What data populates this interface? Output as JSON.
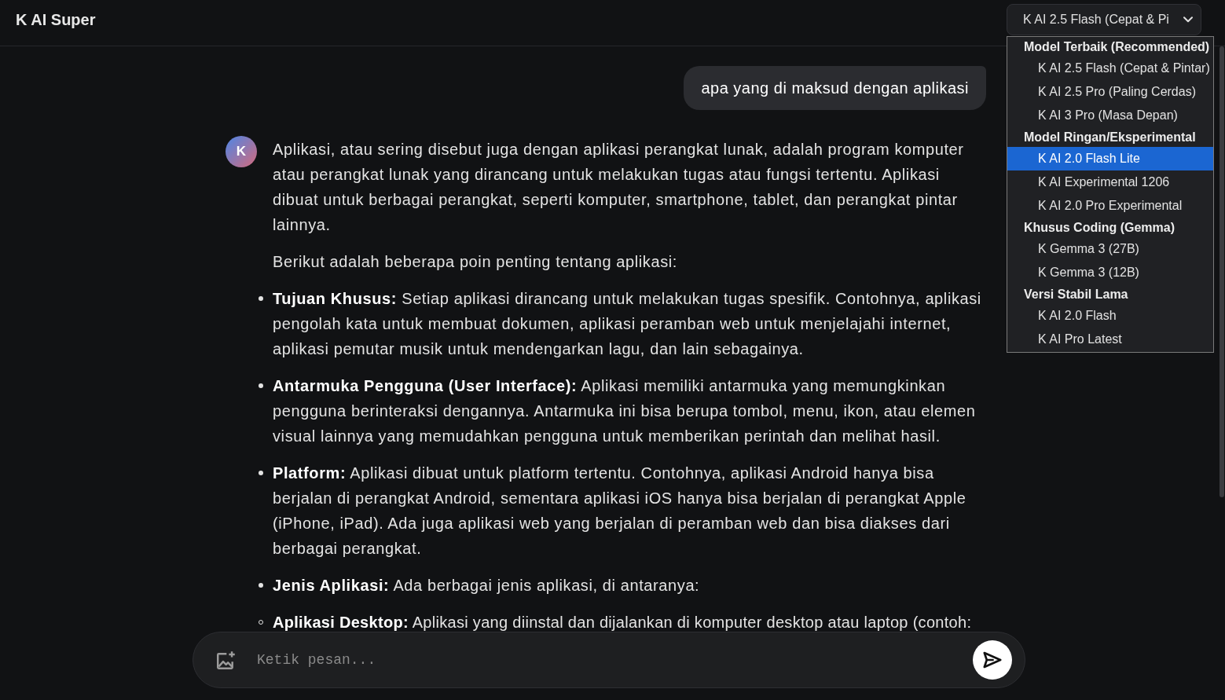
{
  "app": {
    "title": "K AI Super"
  },
  "model_select": {
    "value": "K AI 2.5 Flash (Cepat & Pi",
    "expanded": true,
    "groups": [
      {
        "label": "Model Terbaik (Recommended)",
        "options": [
          {
            "label": "K AI 2.5 Flash (Cepat & Pintar)",
            "selected": false
          },
          {
            "label": "K AI 2.5 Pro (Paling Cerdas)",
            "selected": false
          },
          {
            "label": "K AI 3 Pro (Masa Depan)",
            "selected": false
          }
        ]
      },
      {
        "label": "Model Ringan/Eksperimental",
        "options": [
          {
            "label": "K AI 2.0 Flash Lite",
            "selected": true
          },
          {
            "label": "K AI Experimental 1206",
            "selected": false
          },
          {
            "label": "K AI 2.0 Pro Experimental",
            "selected": false
          }
        ]
      },
      {
        "label": "Khusus Coding (Gemma)",
        "options": [
          {
            "label": "K Gemma 3 (27B)",
            "selected": false
          },
          {
            "label": "K Gemma 3 (12B)",
            "selected": false
          }
        ]
      },
      {
        "label": "Versi Stabil Lama",
        "options": [
          {
            "label": "K AI 2.0 Flash",
            "selected": false
          },
          {
            "label": "K AI Pro Latest",
            "selected": false
          }
        ]
      }
    ]
  },
  "messages": [
    {
      "kind": "user",
      "text": "apa yang di maksud dengan aplikasi"
    },
    {
      "kind": "assistant",
      "avatar": "K",
      "paragraphs": [
        "Aplikasi, atau sering disebut juga dengan aplikasi perangkat lunak, adalah program komputer atau perangkat lunak yang dirancang untuk melakukan tugas atau fungsi tertentu. Aplikasi dibuat untuk berbagai perangkat, seperti komputer, smartphone, tablet, dan perangkat pintar lainnya.",
        "Berikut adalah beberapa poin penting tentang aplikasi:"
      ],
      "bullets": [
        {
          "text": "**Tujuan Khusus:** Setiap aplikasi dirancang untuk melakukan tugas spesifik. Contohnya, aplikasi pengolah kata untuk membuat dokumen, aplikasi peramban web untuk menjelajahi internet, aplikasi pemutar musik untuk mendengarkan lagu, dan lain sebagainya."
        },
        {
          "text": "**Antarmuka Pengguna (User Interface):** Aplikasi memiliki antarmuka yang memungkinkan pengguna berinteraksi dengannya. Antarmuka ini bisa berupa tombol, menu, ikon, atau elemen visual lainnya yang memudahkan pengguna untuk memberikan perintah dan melihat hasil."
        },
        {
          "text": "**Platform:** Aplikasi dibuat untuk platform tertentu. Contohnya, aplikasi Android hanya bisa berjalan di perangkat Android, sementara aplikasi iOS hanya bisa berjalan di perangkat Apple (iPhone, iPad). Ada juga aplikasi web yang berjalan di peramban web dan bisa diakses dari berbagai perangkat."
        },
        {
          "text": "**Jenis Aplikasi:** Ada berbagai jenis aplikasi, di antaranya:",
          "children": [
            {
              "text": "**Aplikasi Desktop:** Aplikasi yang diinstal dan dijalankan di komputer desktop atau laptop (contoh:"
            }
          ]
        }
      ]
    }
  ],
  "composer": {
    "placeholder": "Ketik pesan..."
  }
}
